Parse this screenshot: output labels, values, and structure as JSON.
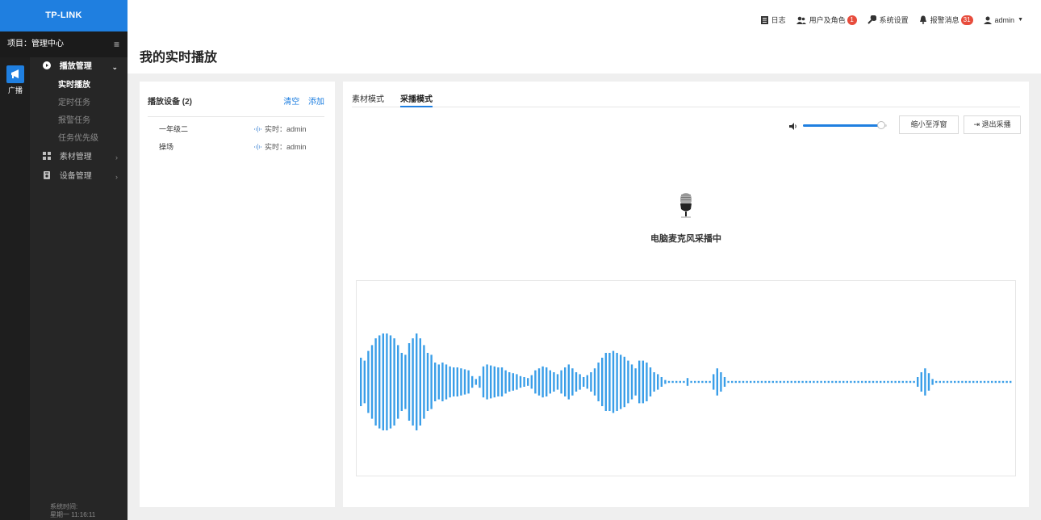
{
  "brand": {
    "logo_text": "TP-LINK"
  },
  "sidebar": {
    "project_label": "项目：管理中心",
    "rail_label": "广播",
    "groups": [
      {
        "label": "播放管理",
        "open": true,
        "items": [
          "实时播放",
          "定时任务",
          "报警任务",
          "任务优先级"
        ],
        "active_item": "实时播放"
      },
      {
        "label": "素材管理",
        "open": false
      },
      {
        "label": "设备管理",
        "open": false
      }
    ],
    "system_time_label": "系统时间:",
    "system_time_value": "星期一 11:16:11"
  },
  "topbar": {
    "log_label": "日志",
    "users_label": "用户及角色",
    "users_badge": "1",
    "settings_label": "系统设置",
    "alarm_label": "报警消息",
    "alarm_badge": "31",
    "account_label": "admin"
  },
  "page": {
    "title": "我的实时播放"
  },
  "device_panel": {
    "title": "播放设备 (2)",
    "clear_label": "清空",
    "add_label": "添加",
    "devices": [
      {
        "name": "一年级二",
        "status": "实时：admin"
      },
      {
        "name": "操场",
        "status": "实时：admin"
      }
    ]
  },
  "capture_panel": {
    "tabs": [
      "素材模式",
      "采播模式"
    ],
    "active_tab": "采播模式",
    "volume_percent": 93,
    "minimize_label": "缩小至浮窗",
    "exit_label": "退出采播",
    "status_text": "电脑麦克风采播中",
    "waveform_amplitudes": [
      0.25,
      0.22,
      0.32,
      0.38,
      0.45,
      0.48,
      0.5,
      0.5,
      0.48,
      0.45,
      0.38,
      0.3,
      0.28,
      0.4,
      0.45,
      0.5,
      0.45,
      0.38,
      0.3,
      0.28,
      0.2,
      0.18,
      0.2,
      0.18,
      0.16,
      0.15,
      0.15,
      0.14,
      0.13,
      0.12,
      0.06,
      0.03,
      0.06,
      0.16,
      0.18,
      0.17,
      0.16,
      0.15,
      0.15,
      0.12,
      0.1,
      0.09,
      0.08,
      0.06,
      0.05,
      0.04,
      0.07,
      0.12,
      0.14,
      0.16,
      0.15,
      0.12,
      0.1,
      0.08,
      0.12,
      0.15,
      0.18,
      0.14,
      0.1,
      0.08,
      0.05,
      0.07,
      0.1,
      0.14,
      0.2,
      0.25,
      0.3,
      0.3,
      0.32,
      0.3,
      0.28,
      0.26,
      0.22,
      0.18,
      0.14,
      0.22,
      0.22,
      0.2,
      0.15,
      0.1,
      0.08,
      0.05,
      0.02,
      0.01,
      0.01,
      0.01,
      0.01,
      0.01,
      0.04,
      0.01,
      0.01,
      0.01,
      0.01,
      0.01,
      0.01,
      0.08,
      0.14,
      0.1,
      0.05,
      0.01,
      0.01,
      0.01,
      0.01,
      0.01,
      0.01,
      0.01,
      0.01,
      0.01,
      0.01,
      0.01,
      0.01,
      0.01,
      0.01,
      0.01,
      0.01,
      0.01,
      0.01,
      0.01,
      0.01,
      0.01,
      0.01,
      0.01,
      0.01,
      0.01,
      0.01,
      0.01,
      0.01,
      0.01,
      0.01,
      0.01,
      0.01,
      0.01,
      0.01,
      0.01,
      0.01,
      0.01,
      0.01,
      0.01,
      0.01,
      0.01,
      0.01,
      0.01,
      0.01,
      0.01,
      0.01,
      0.01,
      0.01,
      0.01,
      0.01,
      0.01,
      0.05,
      0.1,
      0.14,
      0.09,
      0.03,
      0.01,
      0.01,
      0.01,
      0.01,
      0.01,
      0.01,
      0.01,
      0.01,
      0.01,
      0.01,
      0.01,
      0.01,
      0.01,
      0.01,
      0.01,
      0.01,
      0.01,
      0.01,
      0.01,
      0.01,
      0.01,
      0.01,
      0.01,
      0.01,
      0.01
    ]
  },
  "colors": {
    "accent": "#1f7fe0",
    "wave": "#3a9ee8",
    "sidebar": "#262626",
    "badge": "#e74c3c"
  }
}
